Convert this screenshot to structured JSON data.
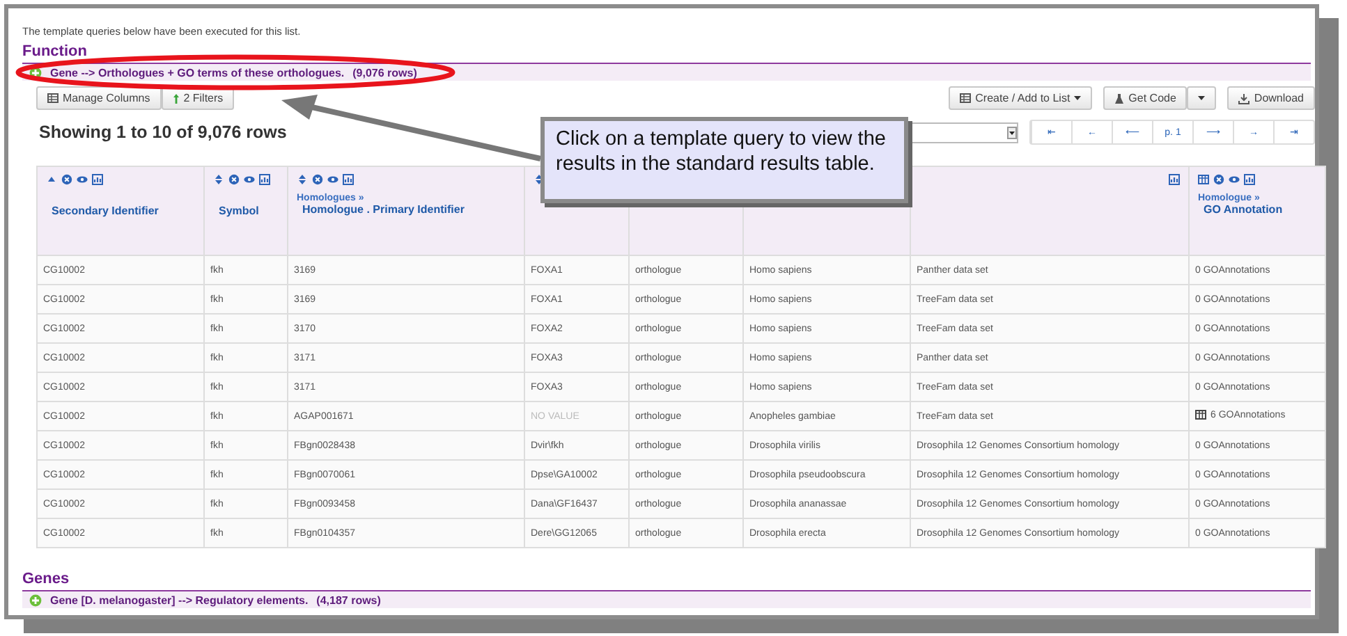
{
  "intro": "The template queries below have been executed for this list.",
  "sections": [
    {
      "heading": "Function",
      "query": {
        "label": "Gene --> Orthologues + GO terms of these orthologues.",
        "count": "(9,076 rows)"
      },
      "toolbar": {
        "left": [
          {
            "label": "Manage Columns"
          },
          {
            "label": "2 Filters"
          }
        ],
        "right": [
          {
            "label": "Create / Add to List",
            "kind": "menu"
          },
          {
            "label": "Get Code",
            "kind": "split"
          },
          {
            "label": "Download",
            "kind": "plain"
          }
        ]
      },
      "summary": "Showing 1 to 10 of 9,076 rows",
      "pager": [
        "⇤",
        "←",
        "⟵",
        "p. 1",
        "⟶",
        "→",
        "⇥"
      ],
      "table": {
        "columns": [
          {
            "kind": "ascending",
            "name": "Secondary Identifier"
          },
          {
            "kind": "sortable",
            "name": "Symbol"
          },
          {
            "kind": "sortable",
            "path": "Homologues »",
            "name": "Homologue . Primary Identifier"
          },
          {
            "kind": "sort-only"
          },
          {
            "kind": "covered"
          },
          {
            "kind": "covered"
          },
          {
            "kind": "partial"
          },
          {
            "kind": "collection",
            "path": "Homologue »",
            "name": "GO Annotation"
          }
        ],
        "rows": [
          {
            "cells": [
              "CG10002",
              "fkh",
              "3169",
              "FOXA1",
              "orthologue",
              "Homo sapiens",
              "Panther data set",
              "0 GOAnnotations"
            ]
          },
          {
            "cells": [
              "CG10002",
              "fkh",
              "3169",
              "FOXA1",
              "orthologue",
              "Homo sapiens",
              "TreeFam data set",
              "0 GOAnnotations"
            ]
          },
          {
            "cells": [
              "CG10002",
              "fkh",
              "3170",
              "FOXA2",
              "orthologue",
              "Homo sapiens",
              "TreeFam data set",
              "0 GOAnnotations"
            ]
          },
          {
            "cells": [
              "CG10002",
              "fkh",
              "3171",
              "FOXA3",
              "orthologue",
              "Homo sapiens",
              "Panther data set",
              "0 GOAnnotations"
            ]
          },
          {
            "cells": [
              "CG10002",
              "fkh",
              "3171",
              "FOXA3",
              "orthologue",
              "Homo sapiens",
              "TreeFam data set",
              "0 GOAnnotations"
            ]
          },
          {
            "cells": [
              "CG10002",
              "fkh",
              "AGAP001671",
              {
                "text": "NO VALUE",
                "kind": "null"
              },
              "orthologue",
              "Anopheles gambiae",
              "TreeFam data set",
              {
                "text": "6 GOAnnotations",
                "kind": "collection"
              }
            ]
          },
          {
            "cells": [
              "CG10002",
              "fkh",
              "FBgn0028438",
              "Dvir\\fkh",
              "orthologue",
              "Drosophila virilis",
              "Drosophila 12 Genomes Consortium homology",
              "0 GOAnnotations"
            ]
          },
          {
            "cells": [
              "CG10002",
              "fkh",
              "FBgn0070061",
              "Dpse\\GA10002",
              "orthologue",
              "Drosophila pseudoobscura",
              "Drosophila 12 Genomes Consortium homology",
              "0 GOAnnotations"
            ]
          },
          {
            "cells": [
              "CG10002",
              "fkh",
              "FBgn0093458",
              "Dana\\GF16437",
              "orthologue",
              "Drosophila ananassae",
              "Drosophila 12 Genomes Consortium homology",
              "0 GOAnnotations"
            ]
          },
          {
            "cells": [
              "CG10002",
              "fkh",
              "FBgn0104357",
              "Dere\\GG12065",
              "orthologue",
              "Drosophila erecta",
              "Drosophila 12 Genomes Consortium homology",
              "0 GOAnnotations"
            ]
          }
        ]
      }
    },
    {
      "heading": "Genes",
      "query": {
        "label": "Gene [D. melanogaster] --> Regulatory elements.",
        "count": "(4,187 rows)"
      }
    }
  ],
  "callout": "Click on a template query to view the results in the standard results table."
}
